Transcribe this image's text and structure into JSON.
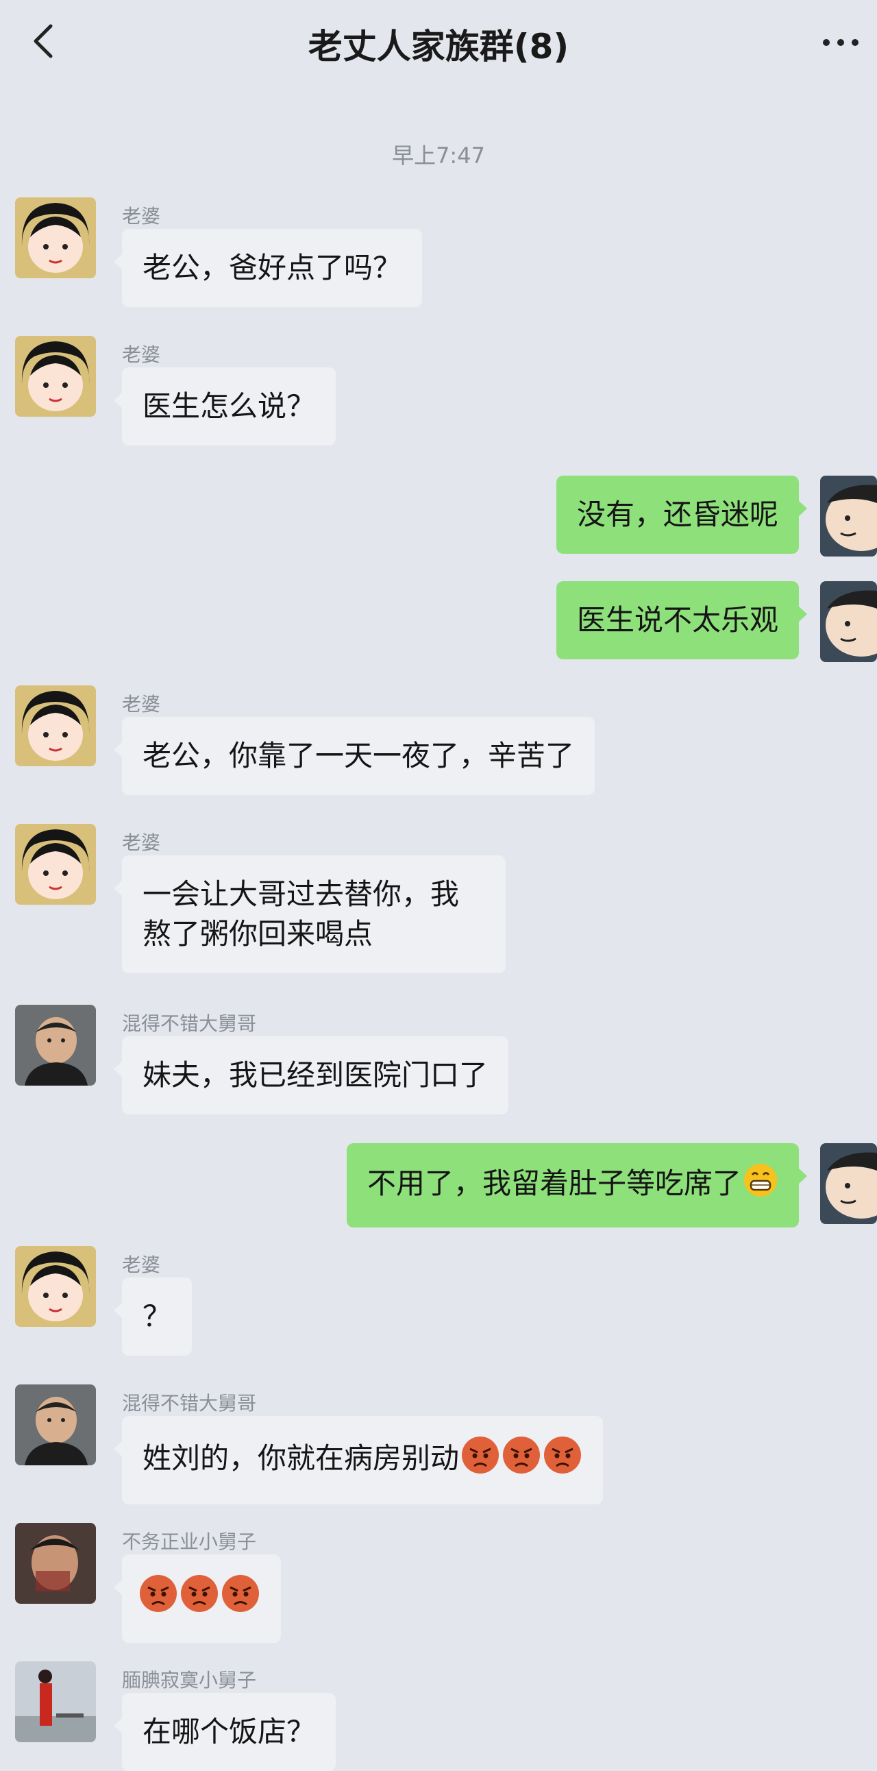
{
  "header": {
    "title": "老丈人家族群(8)"
  },
  "timestamp": "早上7:47",
  "messages": [
    {
      "sender": "老婆",
      "text": "老公，爸好点了吗？"
    },
    {
      "sender": "老婆",
      "text": "医生怎么说？"
    },
    {
      "sender": "me",
      "text": "没有，还昏迷呢"
    },
    {
      "sender": "me",
      "text": "医生说不太乐观"
    },
    {
      "sender": "老婆",
      "text": "老公，你靠了一天一夜了，辛苦了"
    },
    {
      "sender": "老婆",
      "text": "一会让大哥过去替你，我熬了粥你回来喝点"
    },
    {
      "sender": "混得不错大舅哥",
      "text": "妹夫，我已经到医院门口了"
    },
    {
      "sender": "me",
      "text": "不用了，我留着肚子等吃席了",
      "emoji": "grin"
    },
    {
      "sender": "老婆",
      "text": "？"
    },
    {
      "sender": "混得不错大舅哥",
      "text": "姓刘的，你就在病房别动",
      "emoji": "angry x3"
    },
    {
      "sender": "不务正业小舅子",
      "text": "",
      "emoji": "angry x3"
    },
    {
      "sender": "腼腆寂寞小舅子",
      "text": "在哪个饭店？"
    }
  ],
  "icons": {
    "back": "chevron-left-icon",
    "more": "more-dots-icon",
    "grin": "grin-emoji-icon",
    "angry": "angry-emoji-icon"
  }
}
